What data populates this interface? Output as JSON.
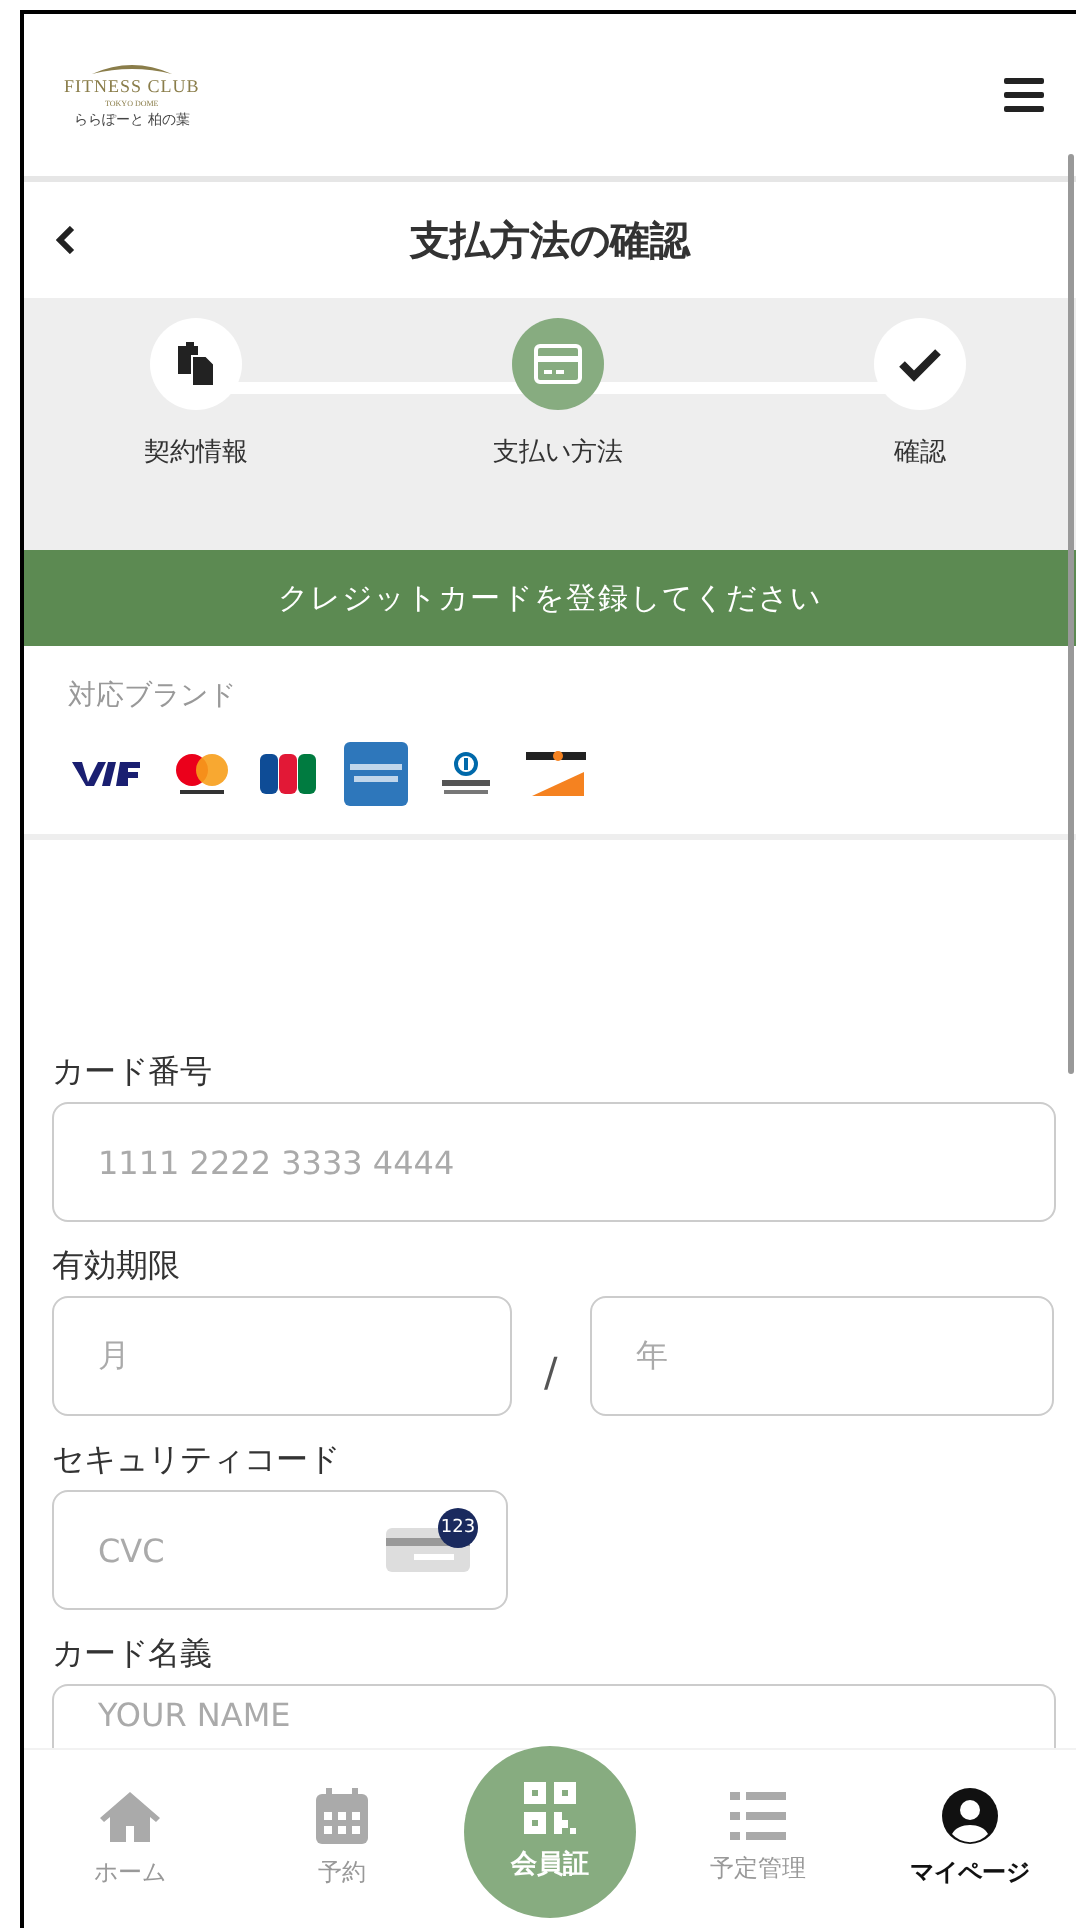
{
  "header": {
    "logo": {
      "name": "FITNESS CLUB",
      "sub": "TOKYO DOME",
      "location": "ららぽーと 柏の葉"
    }
  },
  "title_bar": {
    "title": "支払方法の確認"
  },
  "steps": [
    {
      "label": "契約情報",
      "kind": "documents",
      "selected": false
    },
    {
      "label": "支払い方法",
      "kind": "card",
      "selected": true
    },
    {
      "label": "確認",
      "kind": "check",
      "selected": false
    }
  ],
  "banner": "クレジットカードを登録してください",
  "brands": {
    "label": "対応ブランド",
    "items": [
      {
        "kind": "visa"
      },
      {
        "kind": "mastercard"
      },
      {
        "kind": "jcb"
      },
      {
        "kind": "amex"
      },
      {
        "kind": "diners"
      },
      {
        "kind": "discover"
      }
    ]
  },
  "form": {
    "card_number": {
      "label": "カード番号",
      "placeholder": "1111 2222 3333 4444"
    },
    "expiry": {
      "label": "有効期限",
      "month_placeholder": "月",
      "separator": "/",
      "year_placeholder": "年"
    },
    "security_code": {
      "label": "セキュリティコード",
      "placeholder": "CVC",
      "badge": "123"
    },
    "card_name": {
      "label": "カード名義",
      "placeholder": "YOUR NAME"
    }
  },
  "nav": [
    {
      "label": "ホーム",
      "kind": "home",
      "selected": false
    },
    {
      "label": "予約",
      "kind": "calendar",
      "selected": false
    },
    {
      "label": "会員証",
      "kind": "qr",
      "selected": false
    },
    {
      "label": "予定管理",
      "kind": "list",
      "selected": false
    },
    {
      "label": "マイページ",
      "kind": "user",
      "selected": true
    }
  ]
}
